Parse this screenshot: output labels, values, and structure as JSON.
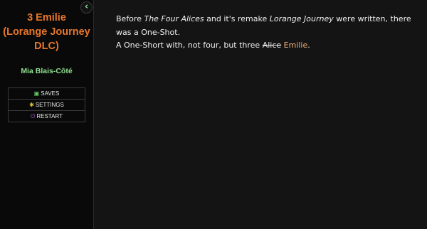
{
  "sidebar": {
    "title_line1": "3 Emilie",
    "title_line2": "(Lorange Journey",
    "title_line3": "DLC)",
    "author": "Mia Blais-Côté",
    "back_icon": "chevron-left-icon",
    "menu": {
      "saves_label": "SAVES",
      "settings_label": "SETTINGS",
      "restart_label": "RESTART"
    }
  },
  "passage": {
    "p1_before": "Before ",
    "p1_title1": "The Four Alices",
    "p1_mid": " and it's remake ",
    "p1_title2": "Lorange Journey",
    "p1_after": " were written, there was a One-Shot.",
    "p2_before": "A One-Short with, not four, but three ",
    "p2_struck": "Alice",
    "p2_link": "Emilie",
    "p2_end": "."
  },
  "colors": {
    "title": "#e8772b",
    "author": "#8fe08f",
    "link": "#f0b078",
    "background": "#141414",
    "sidebar": "#090909"
  }
}
